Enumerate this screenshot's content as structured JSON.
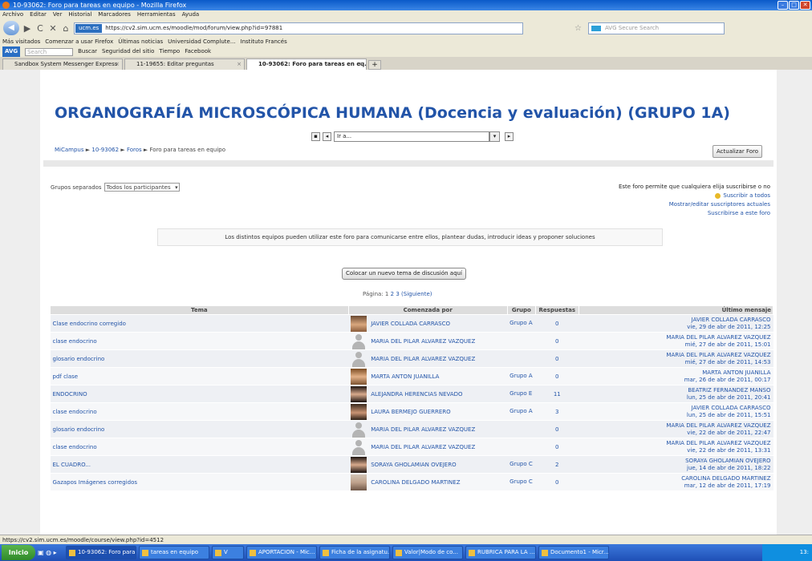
{
  "window": {
    "title": "10-93062: Foro para tareas en equipo - Mozilla Firefox",
    "min": "–",
    "max": "□",
    "close": "✕"
  },
  "menu": [
    "Archivo",
    "Editar",
    "Ver",
    "Historial",
    "Marcadores",
    "Herramientas",
    "Ayuda"
  ],
  "nav": {
    "back": "◀",
    "forward": "▶",
    "reload": "C",
    "stop": "✕",
    "home": "⌂",
    "site_badge": "ucm.es",
    "url": "https://cv2.sim.ucm.es/moodle/mod/forum/view.php?id=97881",
    "star": "☆",
    "search_placeholder": "AVG Secure Search"
  },
  "bookmarks": [
    "Más visitados",
    "Comenzar a usar Firefox",
    "Últimas noticias",
    "Universidad Complute...",
    "Instituto Francés"
  ],
  "avg": {
    "logo": "AVG",
    "search_placeholder": "Search",
    "items": [
      "Buscar",
      "Seguridad del sitio",
      "Tiempo",
      "Facebook"
    ]
  },
  "tabs": [
    {
      "label": "Sandbox System Messenger Express"
    },
    {
      "label": "11-19655: Editar preguntas"
    },
    {
      "label": "10-93062: Foro para tareas en eq..."
    }
  ],
  "course": {
    "title": "ORGANOGRAFÍA MICROSCÓPICA HUMANA (Docencia y evaluación) (GRUPO 1A)",
    "jump_value": "Ir a...",
    "breadcrumb": [
      "MiCampus",
      "10-93062",
      "Foros",
      "Foro para tareas en equipo"
    ],
    "breadcrumb_sep": "►",
    "update_button": "Actualizar Foro"
  },
  "forum": {
    "groups_label": "Grupos separados",
    "groups_value": "Todos los participantes",
    "subscribe_info": "Este foro permite que cualquiera elija suscribirse o no",
    "subscribe_all": "Suscribir a todos",
    "show_subscribers": "Mostrar/editar suscriptores actuales",
    "subscribe_this": "Suscribirse a este foro",
    "intro": "Los distintos equipos pueden utilizar este foro para comunicarse entre ellos, plantear dudas, introducir ideas y proponer soluciones",
    "add_button": "Colocar un nuevo tema de discusión aquí",
    "paging_label": "Página:",
    "pages": [
      "1",
      "2",
      "3"
    ],
    "next": "(Siguiente)"
  },
  "table": {
    "headers": [
      "Tema",
      "Comenzada por",
      "Grupo",
      "Respuestas",
      "Último mensaje"
    ],
    "rows": [
      {
        "topic": "Clase endocrino corregido",
        "author": "JAVIER COLLADA CARRASCO",
        "avatar": "photo",
        "group": "Grupo A",
        "replies": "0",
        "last_author": "JAVIER COLLADA CARRASCO",
        "last_date": "vie, 29 de abr de 2011, 12:25"
      },
      {
        "topic": "clase endocrino",
        "author": "MARIA DEL PILAR ALVAREZ VAZQUEZ",
        "avatar": "def",
        "group": "",
        "replies": "0",
        "last_author": "MARIA DEL PILAR ALVAREZ VAZQUEZ",
        "last_date": "mié, 27 de abr de 2011, 15:01"
      },
      {
        "topic": "glosario endocrino",
        "author": "MARIA DEL PILAR ALVAREZ VAZQUEZ",
        "avatar": "def",
        "group": "",
        "replies": "0",
        "last_author": "MARIA DEL PILAR ALVAREZ VAZQUEZ",
        "last_date": "mié, 27 de abr de 2011, 14:53"
      },
      {
        "topic": "pdf clase",
        "author": "MARTA ANTON JUANILLA",
        "avatar": "photo3",
        "group": "Grupo A",
        "replies": "0",
        "last_author": "MARTA ANTON JUANILLA",
        "last_date": "mar, 26 de abr de 2011, 00:17"
      },
      {
        "topic": "ENDOCRINO",
        "author": "ALEJANDRA HERENCIAS NEVADO",
        "avatar": "photo4",
        "group": "Grupo E",
        "replies": "11",
        "last_author": "BEATRIZ FERNANDEZ MANSO",
        "last_date": "lun, 25 de abr de 2011, 20:41"
      },
      {
        "topic": "clase endocrino",
        "author": "LAURA BERMEJO GUERRERO",
        "avatar": "photo2",
        "group": "Grupo A",
        "replies": "3",
        "last_author": "JAVIER COLLADA CARRASCO",
        "last_date": "lun, 25 de abr de 2011, 15:51"
      },
      {
        "topic": "glosario endocrino",
        "author": "MARIA DEL PILAR ALVAREZ VAZQUEZ",
        "avatar": "def",
        "group": "",
        "replies": "0",
        "last_author": "MARIA DEL PILAR ALVAREZ VAZQUEZ",
        "last_date": "vie, 22 de abr de 2011, 22:47"
      },
      {
        "topic": "clase endocrino",
        "author": "MARIA DEL PILAR ALVAREZ VAZQUEZ",
        "avatar": "def",
        "group": "",
        "replies": "0",
        "last_author": "MARIA DEL PILAR ALVAREZ VAZQUEZ",
        "last_date": "vie, 22 de abr de 2011, 13:31"
      },
      {
        "topic": "EL CUADRO...",
        "author": "SORAYA GHOLAMIAN OVEJERO",
        "avatar": "photo4",
        "group": "Grupo C",
        "replies": "2",
        "last_author": "SORAYA GHOLAMIAN OVEJERO",
        "last_date": "jue, 14 de abr de 2011, 18:22"
      },
      {
        "topic": "Gazapos Imágenes corregidos",
        "author": "CAROLINA DELGADO MARTINEZ",
        "avatar": "photo5",
        "group": "Grupo C",
        "replies": "0",
        "last_author": "CAROLINA DELGADO MARTINEZ",
        "last_date": "mar, 12 de abr de 2011, 17:19"
      }
    ]
  },
  "status_url": "https://cv2.sim.ucm.es/moodle/course/view.php?id=4512",
  "taskbar": {
    "start": "Inicio",
    "items": [
      "10-93062: Foro para ...",
      "tareas en equipo",
      "V",
      "APORTACION - Mic...",
      "Ficha de la asignatu...",
      "Valor|Modo de co...",
      "RUBRICA PARA LA ...",
      "Documento1 - Micr..."
    ],
    "clock": "13:"
  }
}
